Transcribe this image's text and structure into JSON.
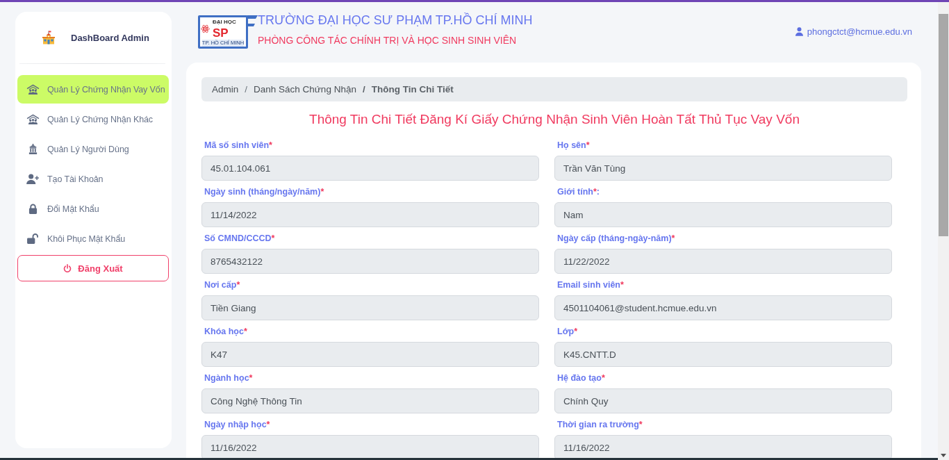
{
  "sidebar": {
    "brand": "DashBoard Admin",
    "items": [
      {
        "label": "Quản Lý Chứng Nhận Vay Vốn",
        "selected": true
      },
      {
        "label": "Quản Lý Chứng Nhận Khác",
        "selected": false
      },
      {
        "label": "Quản Lý Người Dùng",
        "selected": false
      },
      {
        "label": "Tạo Tài Khoản",
        "selected": false
      },
      {
        "label": "Đổi Mật Khẩu",
        "selected": false
      },
      {
        "label": "Khôi Phục Mật Khẩu",
        "selected": false
      }
    ],
    "logout": "Đăng Xuất"
  },
  "header": {
    "logo": {
      "caption_top": "ĐẠI HỌC",
      "initials": "SP",
      "caption_bottom": "TP. HỒ CHÍ MINH"
    },
    "school": "TRƯỜNG ĐẠI HỌC SƯ PHẠM TP.HỒ CHÍ MINH",
    "department": "PHÒNG CÔNG TÁC CHÍNH TRỊ VÀ HỌC SINH SINH VIÊN",
    "user_email": "phongctct@hcmue.edu.vn"
  },
  "breadcrumb": [
    {
      "label": "Admin",
      "current": false
    },
    {
      "separator": "/",
      "label": "Danh Sách Chứng Nhận",
      "current": false
    },
    {
      "separator": "/",
      "label": "Thông Tin Chi Tiết",
      "current": true
    }
  ],
  "page_title": "Thông Tin Chi Tiết Đăng Kí Giấy Chứng Nhận Sinh Viên Hoàn Tất Thủ Tục Vay Vốn",
  "fields": [
    {
      "label": "Mã số sinh viên",
      "required_mark": "*",
      "value": "45.01.104.061",
      "disabled": true
    },
    {
      "label": "Họ sên",
      "required_mark": "*",
      "value": "Trần Văn Tùng",
      "disabled": true
    },
    {
      "label": "Ngày sinh (tháng/ngày/năm)",
      "required_mark": "*",
      "value": "11/14/2022",
      "disabled": true
    },
    {
      "label": "Giới tính",
      "required_mark": "*",
      "label_suffix": ":",
      "value": "Nam",
      "disabled": true
    },
    {
      "label": "Số CMND/CCCD",
      "required_mark": "*",
      "value": "8765432122",
      "disabled": true
    },
    {
      "label": "Ngày cấp (tháng-ngày-năm)",
      "required_mark": "*",
      "value": "11/22/2022",
      "disabled": true
    },
    {
      "label": "Nơi cấp",
      "required_mark": "*",
      "value": "Tiền Giang",
      "disabled": true
    },
    {
      "label": "Email sinh viên",
      "required_mark": "*",
      "value": "4501104061@student.hcmue.edu.vn",
      "disabled": true
    },
    {
      "label": "Khóa học",
      "required_mark": "*",
      "value": "K47",
      "disabled": true
    },
    {
      "label": "Lớp",
      "required_mark": "*",
      "value": "K45.CNTT.D",
      "disabled": true
    },
    {
      "label": "Ngành học",
      "required_mark": "*",
      "value": "Công Nghệ Thông Tin",
      "disabled": true
    },
    {
      "label": "Hệ đào tạo",
      "required_mark": "*",
      "value": "Chính Quy",
      "disabled": true
    },
    {
      "label": "Ngày nhập học",
      "required_mark": "*",
      "value": "11/16/2022",
      "disabled": true
    },
    {
      "label": "Thời gian ra trường",
      "required_mark": "*",
      "value": "11/16/2022",
      "disabled": true
    }
  ]
}
